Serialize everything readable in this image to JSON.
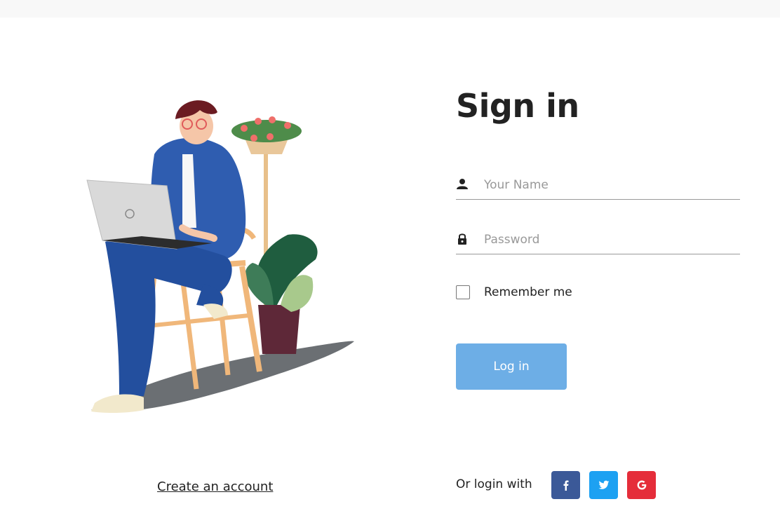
{
  "form": {
    "title": "Sign in",
    "name_placeholder": "Your Name",
    "password_placeholder": "Password",
    "remember_label": "Remember me",
    "login_label": "Log in"
  },
  "links": {
    "create_account": "Create an account"
  },
  "social": {
    "label": "Or login with",
    "buttons": [
      {
        "name": "facebook",
        "icon": "facebook-icon",
        "color": "#3b5998"
      },
      {
        "name": "twitter",
        "icon": "twitter-icon",
        "color": "#1da1f2"
      },
      {
        "name": "google",
        "icon": "google-icon",
        "color": "#e52d3a"
      }
    ]
  },
  "colors": {
    "primary_button": "#6daee6",
    "facebook": "#3b5998",
    "twitter": "#1da1f2",
    "google": "#e52d3a"
  }
}
